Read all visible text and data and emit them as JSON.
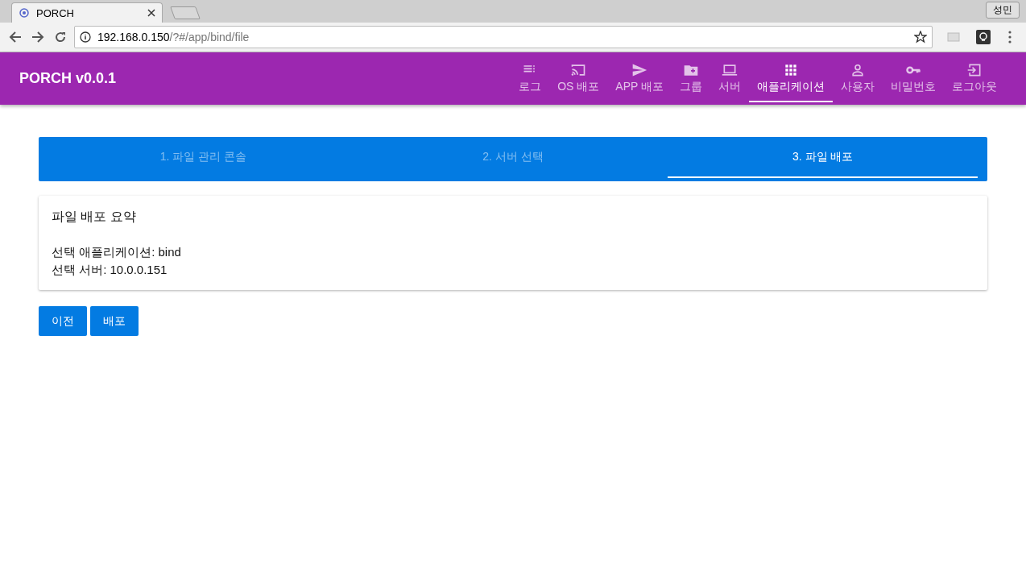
{
  "browser": {
    "tab_title": "PORCH",
    "profile": "성민",
    "url_host": "192.168.0.150",
    "url_path": "/?#/app/bind/file"
  },
  "app_bar": {
    "title": "PORCH v0.0.1",
    "nav": [
      {
        "label": "로그",
        "selected": false
      },
      {
        "label": "OS 배포",
        "selected": false
      },
      {
        "label": "APP 배포",
        "selected": false
      },
      {
        "label": "그룹",
        "selected": false
      },
      {
        "label": "서버",
        "selected": false
      },
      {
        "label": "애플리케이션",
        "selected": true
      },
      {
        "label": "사용자",
        "selected": false
      },
      {
        "label": "비밀번호",
        "selected": false
      },
      {
        "label": "로그아웃",
        "selected": false
      }
    ]
  },
  "steps": [
    {
      "label": "1. 파일 관리 콘솔",
      "selected": false
    },
    {
      "label": "2. 서버 선택",
      "selected": false
    },
    {
      "label": "3. 파일 배포",
      "selected": true
    }
  ],
  "summary": {
    "title": "파일 배포 요약",
    "lines": [
      "선택 애플리케이션: bind",
      "선택 서버: 10.0.0.151"
    ]
  },
  "buttons": [
    "이전",
    "배포"
  ]
}
